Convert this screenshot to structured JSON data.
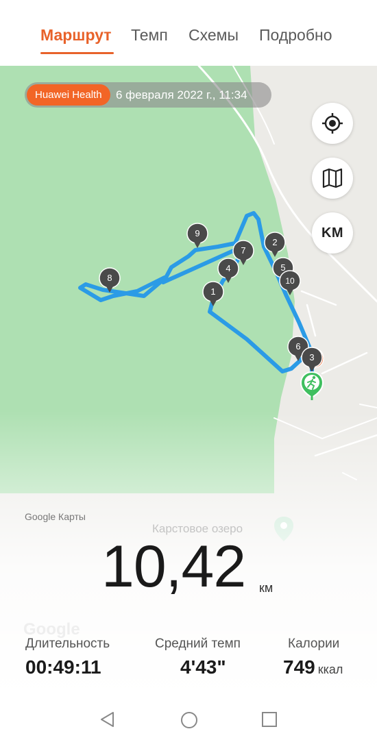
{
  "tabs": [
    {
      "label": "Маршрут",
      "active": true
    },
    {
      "label": "Темп",
      "active": false
    },
    {
      "label": "Схемы",
      "active": false
    },
    {
      "label": "Подробно",
      "active": false
    }
  ],
  "map": {
    "brand_badge": "Huawei Health",
    "datetime": "6 февраля 2022 г., 11:34",
    "km_button": "KM",
    "attribution": "Google Карты",
    "watermark": "Google",
    "place_label": "Карстовое озеро",
    "route_color": "#2b9be6",
    "forest_color": "#aee0b2",
    "markers": [
      "1",
      "2",
      "3",
      "4",
      "5",
      "6",
      "7",
      "8",
      "9",
      "10"
    ]
  },
  "summary": {
    "distance_value": "10,42",
    "distance_unit": "км",
    "stats": [
      {
        "label": "Длительность",
        "value": "00:49:11",
        "unit": ""
      },
      {
        "label": "Средний темп",
        "value": "4'43\"",
        "unit": ""
      },
      {
        "label": "Калории",
        "value": "749",
        "unit": "ккал"
      }
    ]
  },
  "icons": {
    "locate": "crosshair-icon",
    "layers": "map-layers-icon",
    "start": "runner-start-icon",
    "back": "back-triangle-icon",
    "home": "home-circle-icon",
    "recents": "recents-square-icon"
  }
}
